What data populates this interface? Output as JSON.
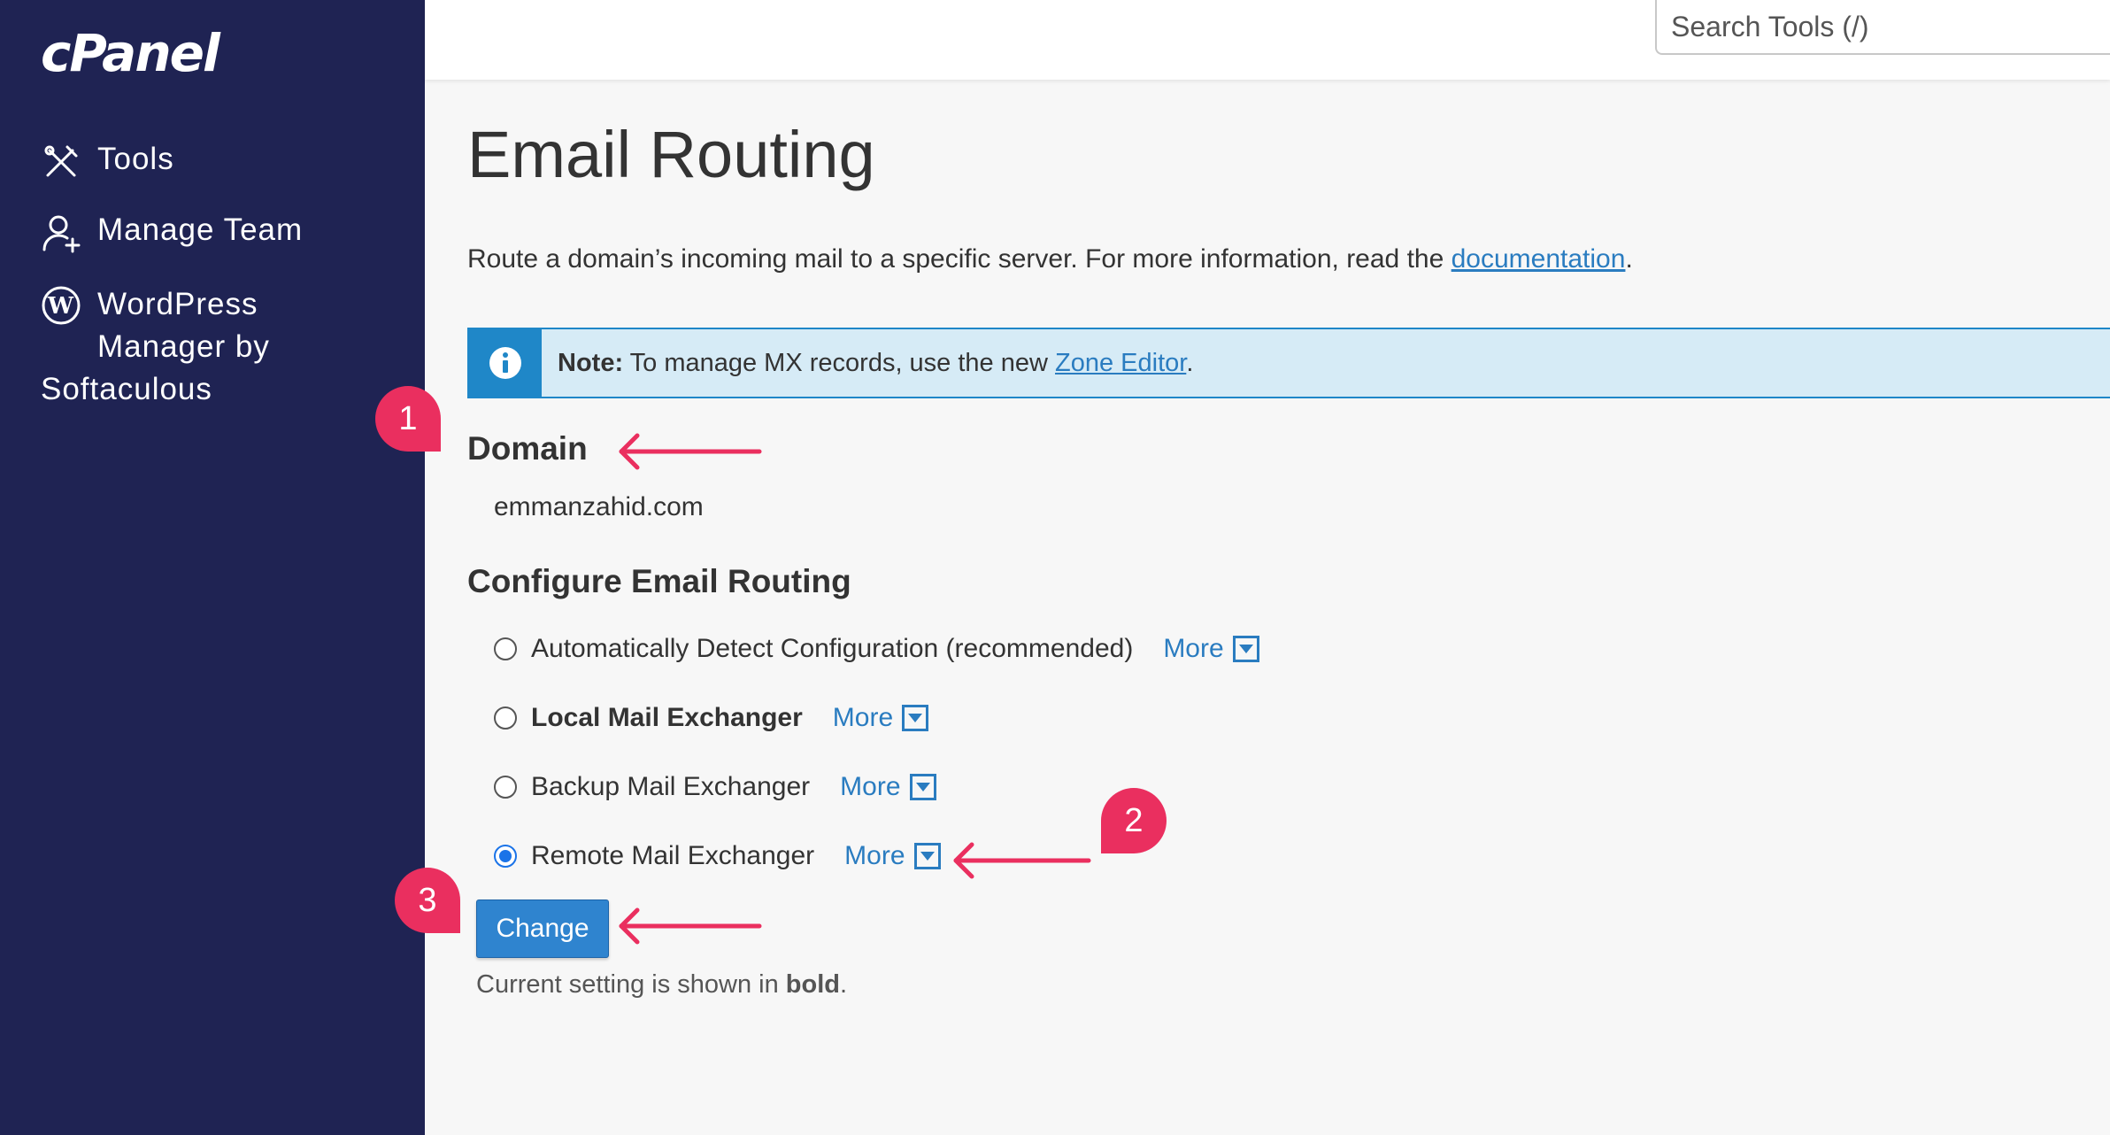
{
  "sidebar": {
    "logo": "cPanel",
    "items": [
      {
        "label": "Tools",
        "icon": "tools-icon"
      },
      {
        "label": "Manage Team",
        "icon": "user-add-icon"
      },
      {
        "label_line1": "WordPress",
        "label_line2": "Manager by",
        "label_line3": "Softaculous",
        "icon": "wordpress-icon"
      }
    ]
  },
  "header": {
    "search_placeholder": "Search Tools (/)"
  },
  "main": {
    "title": "Email Routing",
    "description_prefix": "Route a domain’s incoming mail to a specific server. For more information, read the ",
    "description_link": "documentation",
    "description_suffix": ".",
    "note": {
      "label": "Note:",
      "text_prefix": " To manage MX records, use the new ",
      "link": "Zone Editor",
      "text_suffix": "."
    },
    "domain_heading": "Domain",
    "domain_value": "emmanzahid.com",
    "config_heading": "Configure Email Routing",
    "options": [
      {
        "label": "Automatically Detect Configuration (recommended)",
        "more": "More",
        "checked": false,
        "bold": false
      },
      {
        "label": "Local Mail Exchanger",
        "more": "More",
        "checked": false,
        "bold": true
      },
      {
        "label": "Backup Mail Exchanger",
        "more": "More",
        "checked": false,
        "bold": false
      },
      {
        "label": "Remote Mail Exchanger",
        "more": "More",
        "checked": true,
        "bold": false
      }
    ],
    "change_button": "Change",
    "hint_prefix": "Current setting is shown in ",
    "hint_bold": "bold",
    "hint_suffix": "."
  },
  "annotations": {
    "badges": [
      "1",
      "2",
      "3"
    ],
    "color": "#ea2f5f"
  },
  "colors": {
    "sidebar_bg": "#1f2353",
    "accent": "#2a7cc0",
    "note_bg": "#d6ebf6",
    "annotation": "#ea2f5f"
  }
}
